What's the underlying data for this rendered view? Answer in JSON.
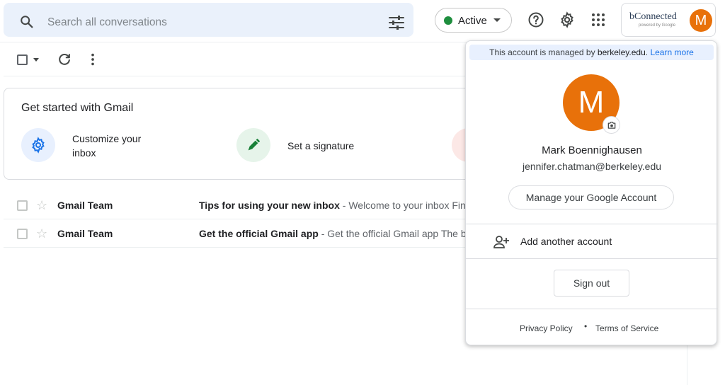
{
  "search": {
    "placeholder": "Search all conversations"
  },
  "status": {
    "label": "Active",
    "color": "#1e8e3e"
  },
  "header": {
    "icons": [
      "help-icon",
      "gear-icon",
      "apps-grid-icon"
    ],
    "org_logo_text": "bConnected",
    "org_logo_sub": "powered by Google",
    "avatar_initial": "M"
  },
  "get_started": {
    "title": "Get started with Gmail",
    "items": [
      {
        "label_line1": "Customize your",
        "label_line2": "inbox",
        "icon": "gear-icon",
        "color": "#1a73e8"
      },
      {
        "label_line1": "Set a signature",
        "label_line2": "",
        "icon": "pen-icon",
        "color": "#188038"
      }
    ]
  },
  "emails": [
    {
      "sender": "Gmail Team",
      "subject": "Tips for using your new inbox",
      "snippet": " - Welcome to your inbox Find"
    },
    {
      "sender": "Gmail Team",
      "subject": "Get the official Gmail app",
      "snippet": " - Get the official Gmail app The b"
    }
  ],
  "account_popup": {
    "managed_prefix": "This account is managed by ",
    "managed_domain": "berkeley.edu",
    "managed_suffix": ".",
    "learn_more": "Learn more",
    "avatar_initial": "M",
    "name": "Mark Boennighausen",
    "email": "jennifer.chatman@berkeley.edu",
    "manage_label": "Manage your Google Account",
    "add_account_label": "Add another account",
    "sign_out_label": "Sign out",
    "privacy_label": "Privacy Policy",
    "dot": "•",
    "terms_label": "Terms of Service"
  },
  "colors": {
    "accent": "#1a73e8",
    "avatar": "#e8710a"
  }
}
